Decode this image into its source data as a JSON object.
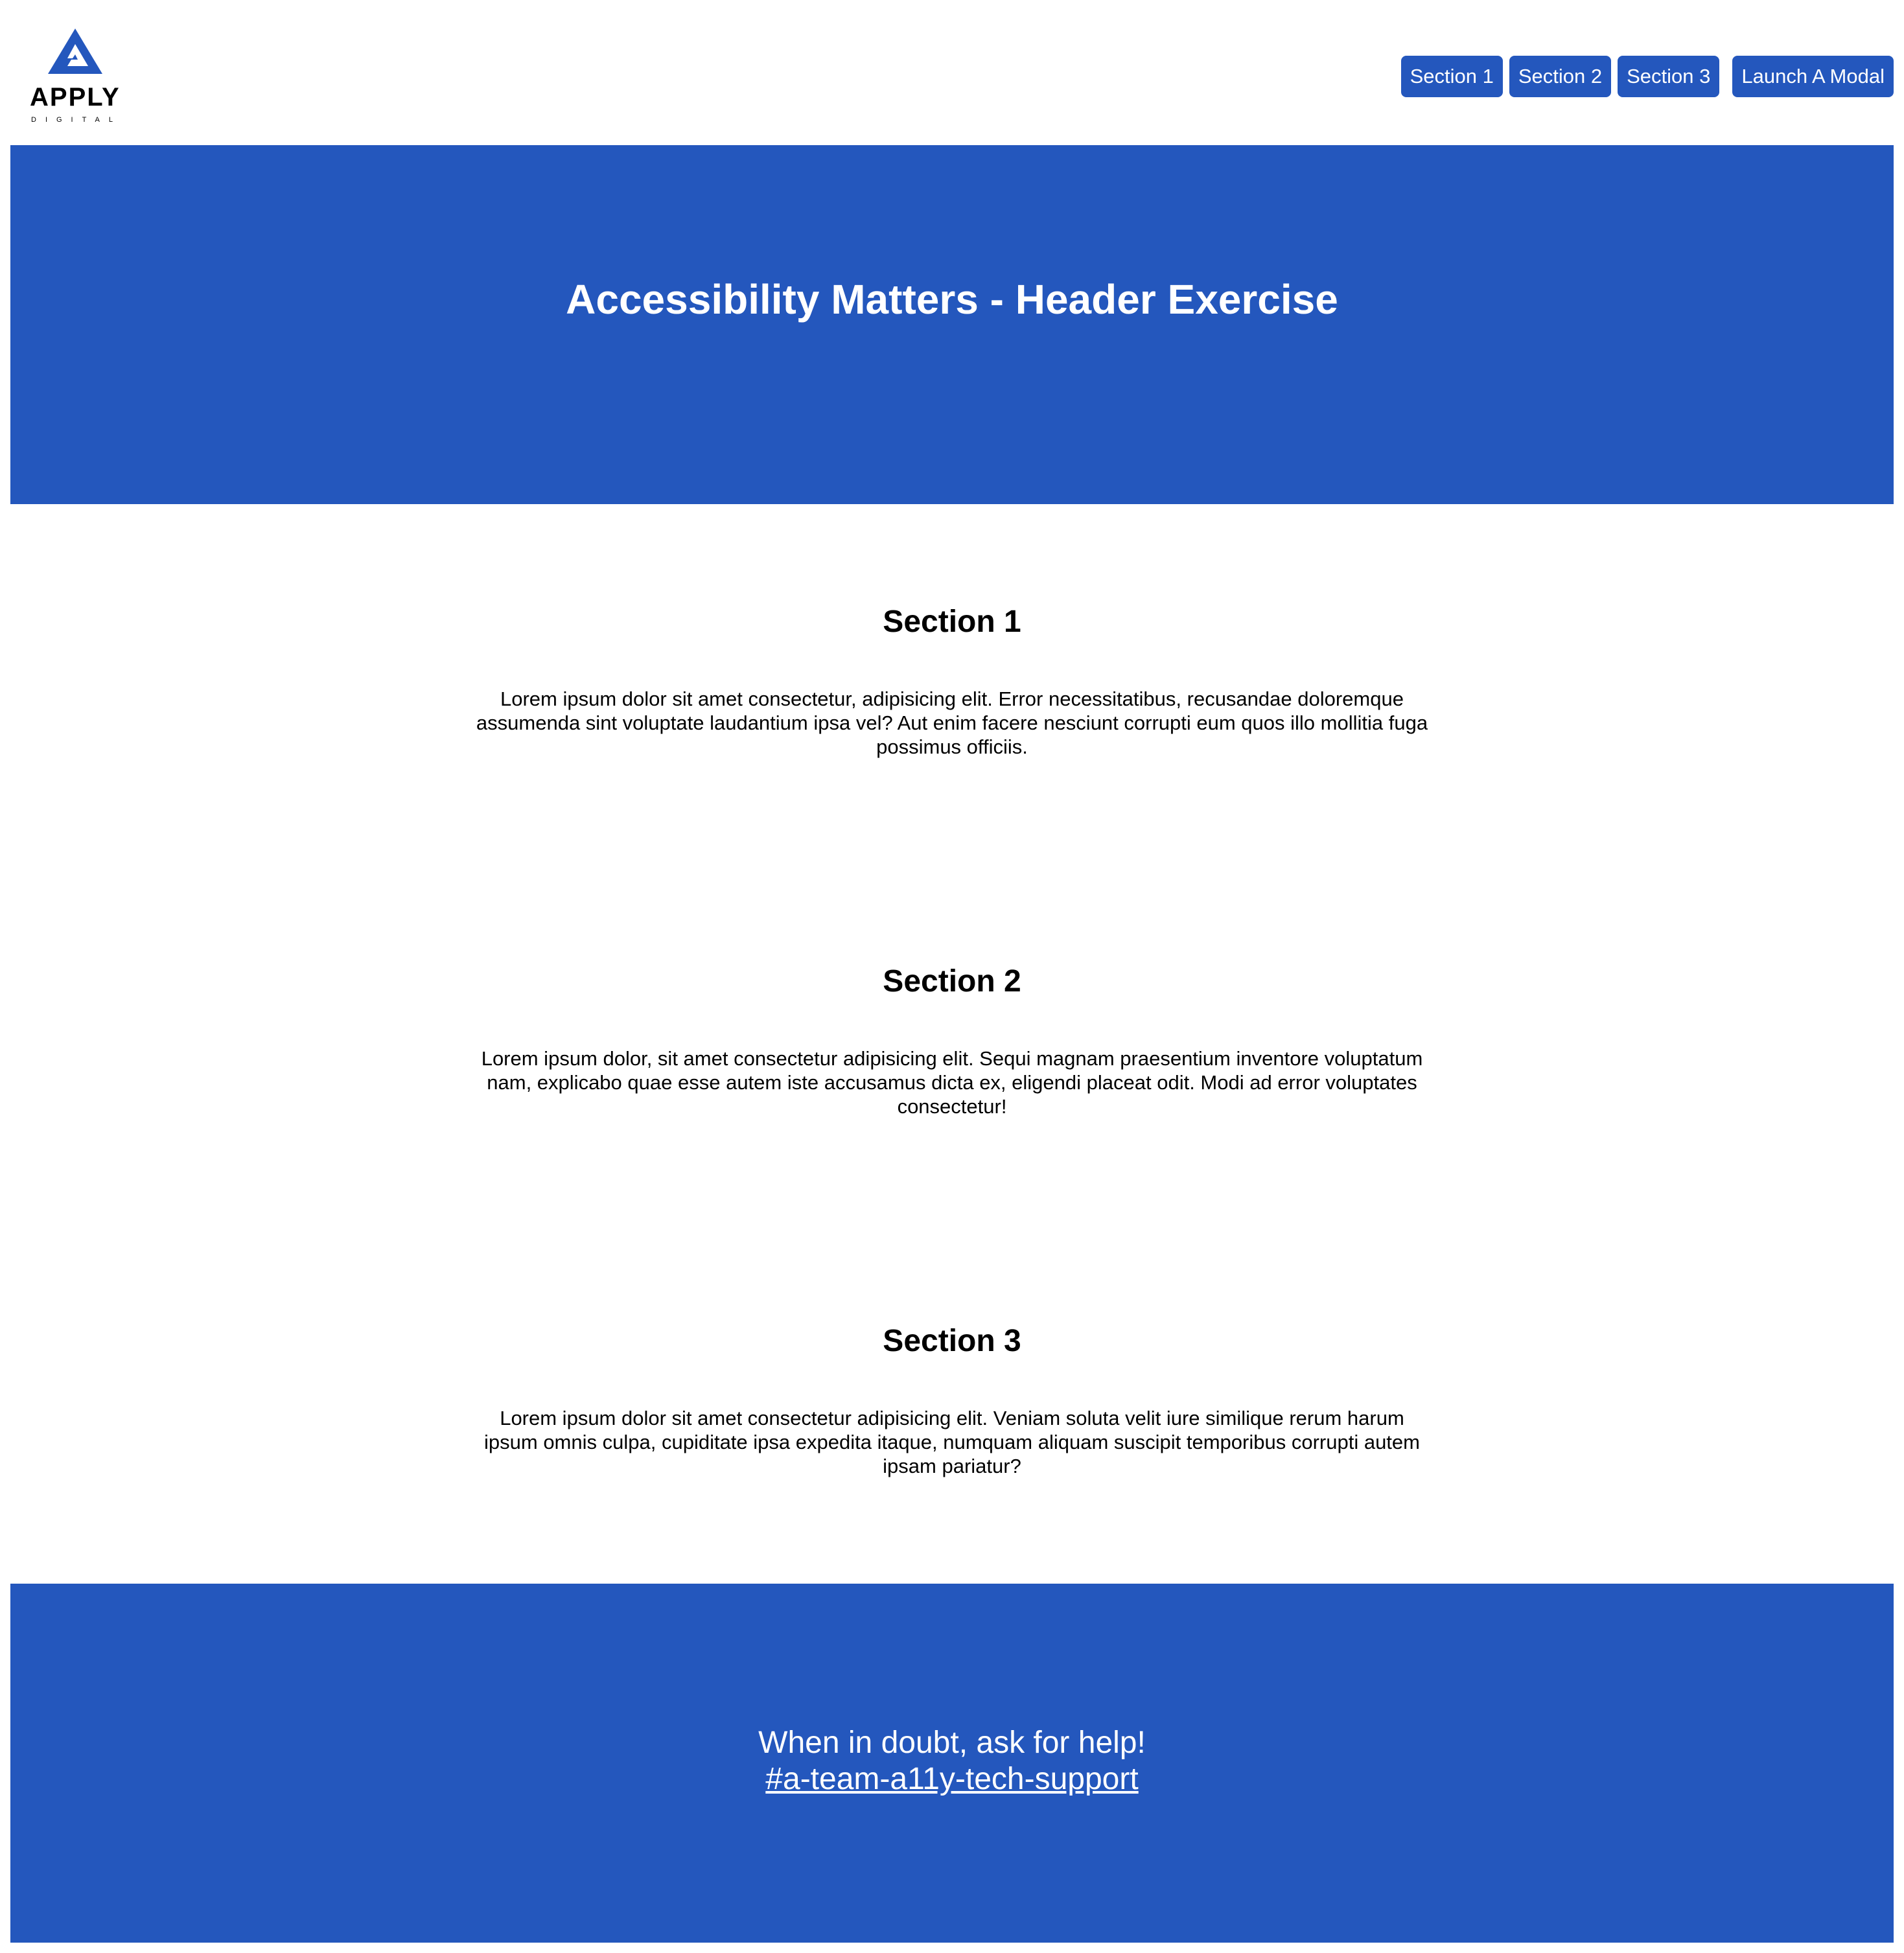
{
  "brand": {
    "logo_word": "APPLY",
    "logo_sub": "DIGITAL"
  },
  "nav": {
    "items": [
      {
        "label": "Section 1"
      },
      {
        "label": "Section 2"
      },
      {
        "label": "Section 3"
      }
    ],
    "modal_button": "Launch A Modal"
  },
  "hero": {
    "title": "Accessibility Matters - Header Exercise"
  },
  "sections": [
    {
      "heading": "Section 1",
      "body": "Lorem ipsum dolor sit amet consectetur, adipisicing elit. Error necessitatibus, recusandae doloremque assumenda sint voluptate laudantium ipsa vel? Aut enim facere nesciunt corrupti eum quos illo mollitia fuga possimus officiis."
    },
    {
      "heading": "Section 2",
      "body": "Lorem ipsum dolor, sit amet consectetur adipisicing elit. Sequi magnam praesentium inventore voluptatum nam, explicabo quae esse autem iste accusamus dicta ex, eligendi placeat odit. Modi ad error voluptates consectetur!"
    },
    {
      "heading": "Section 3",
      "body": "Lorem ipsum dolor sit amet consectetur adipisicing elit. Veniam soluta velit iure similique rerum harum ipsum omnis culpa, cupiditate ipsa expedita itaque, numquam aliquam suscipit temporibus corrupti autem ipsam pariatur?"
    }
  ],
  "footer": {
    "text": "When in doubt, ask for help!",
    "link_text": "#a-team-a11y-tech-support"
  },
  "colors": {
    "brand_blue": "#2457bd",
    "text": "#000000",
    "background": "#ffffff"
  }
}
